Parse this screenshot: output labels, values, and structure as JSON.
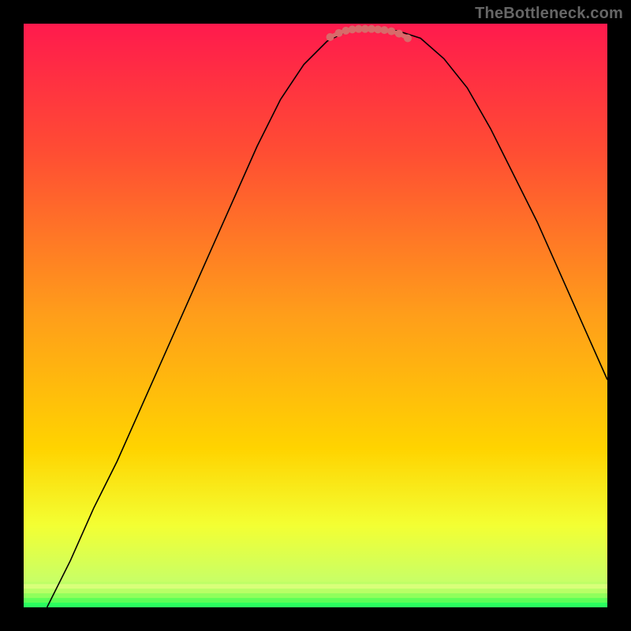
{
  "watermark": {
    "text": "TheBottleneck.com"
  },
  "chart_data": {
    "type": "line",
    "title": "",
    "xlabel": "",
    "ylabel": "",
    "xlim": [
      0,
      100
    ],
    "ylim": [
      0,
      100
    ],
    "gradient": {
      "top_color": "#ff1a4d",
      "mid_color": "#ffd400",
      "bottom_color": "#2aff5f",
      "stops": [
        {
          "offset": 0.0,
          "color": "#ff1a4d"
        },
        {
          "offset": 0.22,
          "color": "#ff4d33"
        },
        {
          "offset": 0.5,
          "color": "#ff9e1a"
        },
        {
          "offset": 0.73,
          "color": "#ffd400"
        },
        {
          "offset": 0.86,
          "color": "#f3ff33"
        },
        {
          "offset": 0.955,
          "color": "#c8ff66"
        },
        {
          "offset": 1.0,
          "color": "#2aff5f"
        }
      ]
    },
    "bottom_stripe_bands": [
      {
        "color": "#d9ff7a",
        "y": 96.0,
        "height": 0.8
      },
      {
        "color": "#b8ff66",
        "y": 96.8,
        "height": 0.8
      },
      {
        "color": "#8fff5c",
        "y": 97.6,
        "height": 0.8
      },
      {
        "color": "#5cff57",
        "y": 98.4,
        "height": 0.8
      },
      {
        "color": "#2aff5f",
        "y": 99.2,
        "height": 0.8
      }
    ],
    "series": [
      {
        "name": "curve",
        "stroke": "#000000",
        "stroke_width": 1.6,
        "x": [
          4,
          8,
          12,
          16,
          20,
          24,
          28,
          32,
          36,
          40,
          44,
          48,
          52,
          55,
          58,
          61,
          64,
          68,
          72,
          76,
          80,
          84,
          88,
          92,
          96,
          100
        ],
        "y": [
          0,
          8,
          17,
          25,
          34,
          43,
          52,
          61,
          70,
          79,
          87,
          93,
          97,
          98.5,
          99,
          99,
          98.8,
          97.5,
          94,
          89,
          82,
          74,
          66,
          57,
          48,
          39
        ]
      }
    ],
    "markers": {
      "color": "#d86a6a",
      "radius": 5,
      "points": [
        {
          "x": 52.5,
          "y": 97.7
        },
        {
          "x": 54.0,
          "y": 98.4
        },
        {
          "x": 55.2,
          "y": 98.8
        },
        {
          "x": 56.3,
          "y": 99.0
        },
        {
          "x": 57.4,
          "y": 99.1
        },
        {
          "x": 58.5,
          "y": 99.1
        },
        {
          "x": 59.6,
          "y": 99.1
        },
        {
          "x": 60.7,
          "y": 99.0
        },
        {
          "x": 61.8,
          "y": 98.9
        },
        {
          "x": 63.0,
          "y": 98.7
        },
        {
          "x": 64.3,
          "y": 98.3
        },
        {
          "x": 65.8,
          "y": 97.5
        }
      ],
      "path_stroke_width": 5
    }
  }
}
